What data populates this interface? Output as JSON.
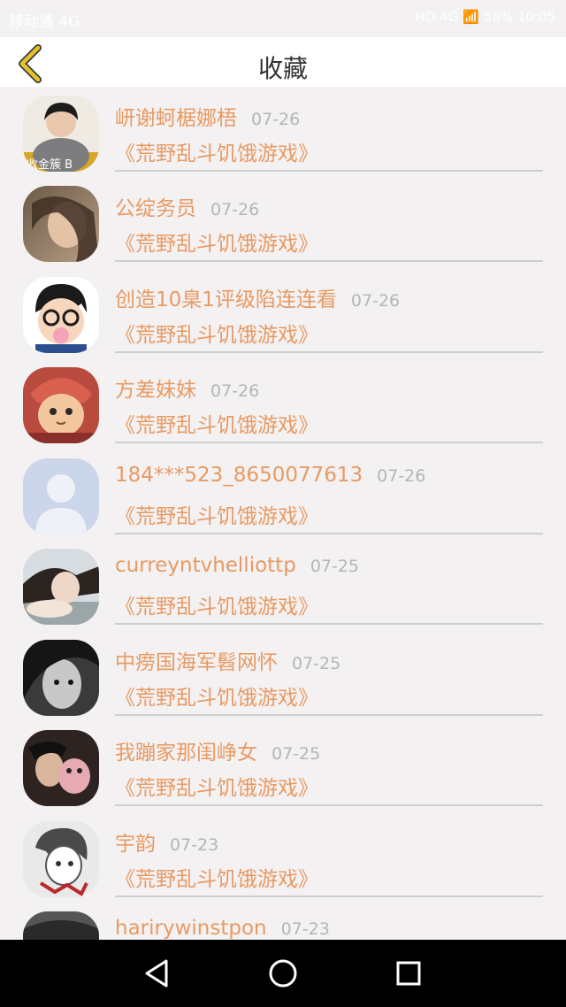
{
  "status": {
    "left": "移动通 4G",
    "right": "HD 4G 📶 58% 10:05"
  },
  "header": {
    "title": "收藏"
  },
  "colors": {
    "accent": "#e89a62",
    "date": "#b5b5b5",
    "back_icon": "#e6c22a"
  },
  "items": [
    {
      "nickname": "岍谢蚵椐娜梧",
      "date": "07-26",
      "game": "《荒野乱斗饥饿游戏》",
      "avatar": "avatar-boy-hoodie"
    },
    {
      "nickname": "公绽务员",
      "date": "07-26",
      "game": "《荒野乱斗饥饿游戏》",
      "avatar": "avatar-girl-sky"
    },
    {
      "nickname": "创造10臬1评级陷连连看",
      "date": "07-26",
      "game": "《荒野乱斗饥饿游戏》",
      "avatar": "avatar-cartoon-conan"
    },
    {
      "nickname": "方差妹妹",
      "date": "07-26",
      "game": "《荒野乱斗饥饿游戏》",
      "avatar": "avatar-cat-costume"
    },
    {
      "nickname": "184***523_8650077613",
      "date": "07-26",
      "game": "《荒野乱斗饥饿游戏》",
      "avatar": "avatar-default-person"
    },
    {
      "nickname": "curreyntvhelliottp",
      "date": "07-25",
      "game": "《荒野乱斗饥饿游戏》",
      "avatar": "avatar-girl-lying"
    },
    {
      "nickname": "中痨国海军髫网怀",
      "date": "07-25",
      "game": "《荒野乱斗饥饿游戏》",
      "avatar": "avatar-bw-portrait"
    },
    {
      "nickname": "我蹦家那闺峥女",
      "date": "07-25",
      "game": "《荒野乱斗饥饿游戏》",
      "avatar": "avatar-girl-plush"
    },
    {
      "nickname": "宇韵",
      "date": "07-23",
      "game": "《荒野乱斗饥饿游戏》",
      "avatar": "avatar-anime-sketch"
    },
    {
      "nickname": "harirywinstpon",
      "date": "07-23",
      "game": "",
      "avatar": "avatar-dark-partial"
    }
  ],
  "navbar": {
    "back": "back-triangle-icon",
    "home": "home-circle-icon",
    "recents": "recents-square-icon"
  }
}
